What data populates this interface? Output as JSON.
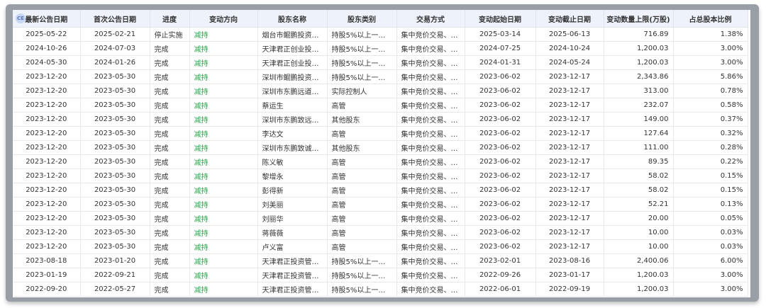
{
  "badge": "CE",
  "columns": [
    "最新公告日期",
    "首次公告日期",
    "进度",
    "变动方向",
    "股东名称",
    "股东类别",
    "交易方式",
    "变动起始日期",
    "变动截止日期",
    "变动数量上限(万股)",
    "占总股本比例"
  ],
  "rows": [
    [
      "2025-05-22",
      "2025-02-21",
      "停止实施",
      "减持",
      "烟台市鲲鹏投资发...",
      "持股5%以上一般股...",
      "集中竞价交易、大...",
      "2025-03-14",
      "2025-06-13",
      "716.89",
      "1.38%"
    ],
    [
      "2024-10-26",
      "2024-07-03",
      "完成",
      "减持",
      "天津君正创业投资...",
      "持股5%以上一般股...",
      "集中竞价交易、大...",
      "2024-07-25",
      "2024-10-24",
      "1,200.03",
      "3.00%"
    ],
    [
      "2024-05-30",
      "2024-01-26",
      "完成",
      "减持",
      "天津君正创业投资...",
      "持股5%以上一般股...",
      "集中竞价交易、大...",
      "2024-01-31",
      "2024-05-24",
      "1,200.03",
      "3.00%"
    ],
    [
      "2023-12-20",
      "2023-05-30",
      "完成",
      "减持",
      "深圳市鲲鹏投资发...",
      "持股5%以上一般股...",
      "集中竞价交易、大...",
      "2023-06-02",
      "2023-12-17",
      "2,343.86",
      "5.86%"
    ],
    [
      "2023-12-20",
      "2023-05-30",
      "完成",
      "减持",
      "深圳市东鹏远道投...",
      "实际控制人",
      "集中竞价交易、大...",
      "2023-06-02",
      "2023-12-17",
      "313.00",
      "0.78%"
    ],
    [
      "2023-12-20",
      "2023-05-30",
      "完成",
      "减持",
      "蔡运生",
      "高管",
      "集中竞价交易、大...",
      "2023-06-02",
      "2023-12-17",
      "232.07",
      "0.58%"
    ],
    [
      "2023-12-20",
      "2023-05-30",
      "完成",
      "减持",
      "深圳市东鹏致远投...",
      "其他股东",
      "集中竞价交易、大...",
      "2023-06-02",
      "2023-12-17",
      "149.00",
      "0.37%"
    ],
    [
      "2023-12-20",
      "2023-05-30",
      "完成",
      "减持",
      "李达文",
      "高管",
      "集中竞价交易、大...",
      "2023-06-02",
      "2023-12-17",
      "127.64",
      "0.32%"
    ],
    [
      "2023-12-20",
      "2023-05-30",
      "完成",
      "减持",
      "深圳市东鹏致诚投...",
      "其他股东",
      "集中竞价交易、大...",
      "2023-06-02",
      "2023-12-17",
      "111.00",
      "0.28%"
    ],
    [
      "2023-12-20",
      "2023-05-30",
      "完成",
      "减持",
      "陈义敏",
      "高管",
      "集中竞价交易、大...",
      "2023-06-02",
      "2023-12-17",
      "89.35",
      "0.22%"
    ],
    [
      "2023-12-20",
      "2023-05-30",
      "完成",
      "减持",
      "黎增永",
      "高管",
      "集中竞价交易、大...",
      "2023-06-02",
      "2023-12-17",
      "58.02",
      "0.15%"
    ],
    [
      "2023-12-20",
      "2023-05-30",
      "完成",
      "减持",
      "彭得新",
      "高管",
      "集中竞价交易、大...",
      "2023-06-02",
      "2023-12-17",
      "58.02",
      "0.15%"
    ],
    [
      "2023-12-20",
      "2023-05-30",
      "完成",
      "减持",
      "刘美丽",
      "高管",
      "集中竞价交易、大...",
      "2023-06-02",
      "2023-12-17",
      "52.21",
      "0.13%"
    ],
    [
      "2023-12-20",
      "2023-05-30",
      "完成",
      "减持",
      "刘丽华",
      "高管",
      "集中竞价交易、大...",
      "2023-06-02",
      "2023-12-17",
      "20.00",
      "0.05%"
    ],
    [
      "2023-12-20",
      "2023-05-30",
      "完成",
      "减持",
      "蒋薇薇",
      "高管",
      "集中竞价交易、大...",
      "2023-06-02",
      "2023-12-17",
      "10.00",
      "0.03%"
    ],
    [
      "2023-12-20",
      "2023-05-30",
      "完成",
      "减持",
      "卢义富",
      "高管",
      "集中竞价交易、大...",
      "2023-06-02",
      "2023-12-17",
      "10.00",
      "0.03%"
    ],
    [
      "2023-08-18",
      "2023-01-20",
      "完成",
      "减持",
      "天津君正投资管理...",
      "持股5%以上一般股...",
      "集中竞价交易、大...",
      "2023-02-01",
      "2023-08-16",
      "2,400.06",
      "6.00%"
    ],
    [
      "2023-01-19",
      "2022-09-21",
      "完成",
      "减持",
      "天津君正投资管理...",
      "持股5%以上一般股...",
      "集中竞价交易、大...",
      "2022-09-26",
      "2023-01-17",
      "1,200.03",
      "3.00%"
    ],
    [
      "2022-09-20",
      "2022-05-27",
      "完成",
      "减持",
      "天津君正投资管理...",
      "持股5%以上一般股...",
      "集中竞价交易、大...",
      "2022-06-01",
      "2022-09-19",
      "1,200.03",
      "3.00%"
    ]
  ],
  "colors": {
    "direction_text": "#27a24a",
    "header_bg": "#eef3fb"
  }
}
